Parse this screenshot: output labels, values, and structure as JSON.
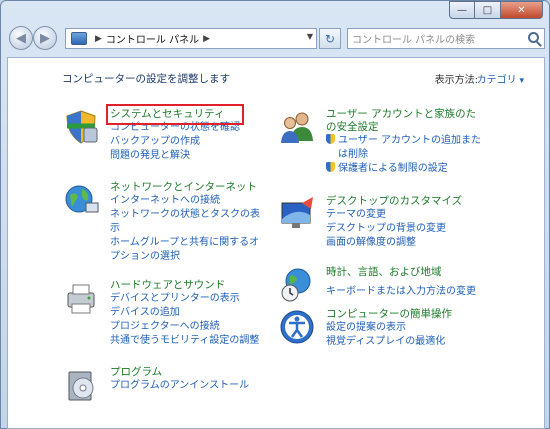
{
  "window": {
    "minimize_glyph": "—",
    "maximize_glyph": "□",
    "close_glyph": "✕"
  },
  "address_bar": {
    "breadcrumb": "コントロール パネル"
  },
  "search": {
    "placeholder": "コントロール パネルの検索"
  },
  "page": {
    "heading": "コンピューターの設定を調整します",
    "view_by_label": "表示方法:",
    "view_by_value": "カテゴリ"
  },
  "categories": {
    "system": {
      "title": "システムとセキュリティ",
      "links": [
        "コンピューターの状態を確認",
        "バックアップの作成",
        "問題の発見と解決"
      ]
    },
    "network": {
      "title": "ネットワークとインターネット",
      "links": [
        "インターネットへの接続",
        "ネットワークの状態とタスクの表",
        "示",
        "ホームグループと共有に関するオ",
        "プションの選択"
      ]
    },
    "hardware": {
      "title": "ハードウェアとサウンド",
      "links": [
        "デバイスとプリンターの表示",
        "デバイスの追加",
        "プロジェクターへの接続",
        "共通で使うモビリティ設定の調整"
      ]
    },
    "programs": {
      "title": "プログラム",
      "links": [
        "プログラムのアンインストール"
      ]
    },
    "users": {
      "title_line1": "ユーザー アカウントと家族のた",
      "title_line2": "め",
      "title_line3": "の安全設定",
      "links": [
        "ユーザー アカウントの追加また",
        "は削除",
        "保護者による制限の設定"
      ]
    },
    "appearance": {
      "title": "デスクトップのカスタマイズ",
      "links": [
        "テーマの変更",
        "デスクトップの背景の変更",
        "画面の解像度の調整"
      ]
    },
    "clock": {
      "title": "時計、言語、および地域",
      "links": [
        "キーボードまたは入力方法の変更"
      ]
    },
    "access": {
      "title": "コンピューターの簡単操作",
      "links": [
        "設定の提案の表示",
        "視覚ディスプレイの最適化"
      ]
    }
  },
  "colors": {
    "title_link": "#1d7a2a",
    "sub_link": "#1f5fb8",
    "highlight": "#e0202a"
  }
}
